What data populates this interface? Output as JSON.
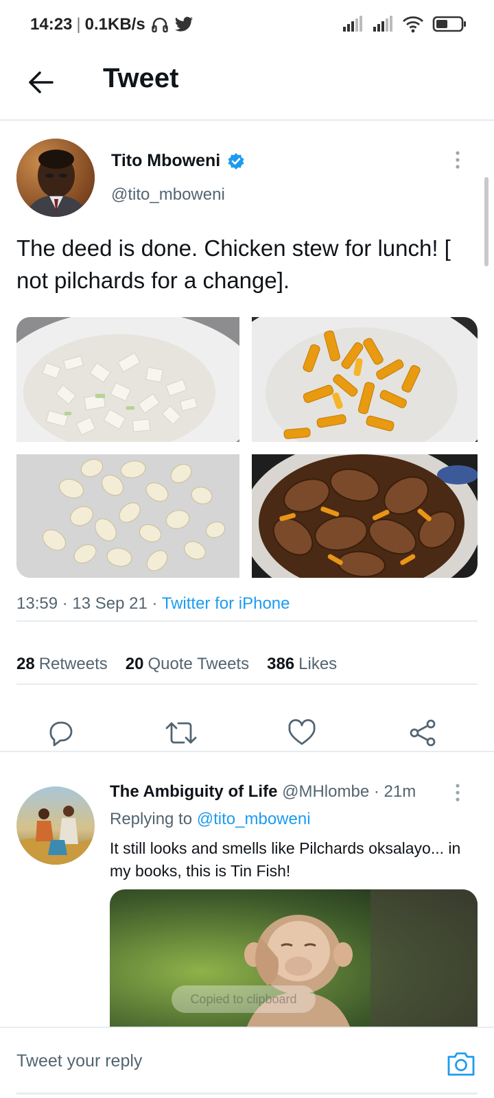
{
  "status_bar": {
    "time": "14:23",
    "speed": "0.1KB/s"
  },
  "header": {
    "title": "Tweet"
  },
  "tweet": {
    "author_name": "Tito Mboweni",
    "author_handle": "@tito_mboweni",
    "text": "The deed is done. Chicken stew for lunch! [ not pilchards for a change].",
    "time": "13:59",
    "date": "13 Sep 21",
    "source": "Twitter for iPhone",
    "stats": {
      "retweets_count": "28",
      "retweets_label": "Retweets",
      "quotes_count": "20",
      "quotes_label": "Quote Tweets",
      "likes_count": "386",
      "likes_label": "Likes"
    }
  },
  "reply": {
    "author_name": "The Ambiguity of Life",
    "author_handle": "@MHlombe",
    "age": "21m",
    "replying_label": "Replying to",
    "replying_handle": "@tito_mboweni",
    "text": "It still looks and smells like Pilchards oksalayo... in my books, this is Tin Fish!"
  },
  "toast": {
    "text": "Copied to clipboard"
  },
  "compose": {
    "placeholder": "Tweet your reply"
  },
  "colors": {
    "accent": "#1d9bf0",
    "text": "#0f1419",
    "secondary": "#536471",
    "divider": "#e6ecf0"
  },
  "icons": [
    "headphones-icon",
    "twitter-bird-icon",
    "signal-icon",
    "wifi-icon",
    "battery-icon",
    "back-arrow-icon",
    "verified-badge-icon",
    "more-vertical-icon",
    "reply-icon",
    "retweet-icon",
    "like-icon",
    "share-icon",
    "camera-icon"
  ]
}
